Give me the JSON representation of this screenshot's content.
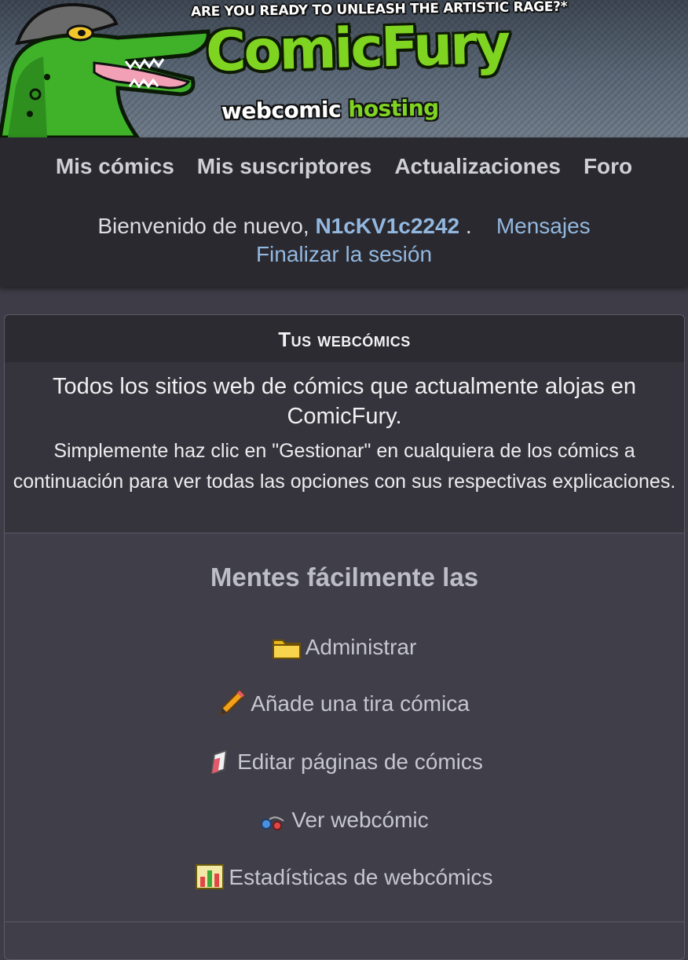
{
  "banner": {
    "tagline": "ARE YOU READY TO UNLEASH THE ARTISTIC RAGE?",
    "tagline_mark": "*",
    "logo_main": "ComicFury",
    "logo_sub_1": "webcomic",
    "logo_sub_2": "hosting"
  },
  "nav": {
    "items": [
      "Mis cómics",
      "Mis suscriptores",
      "Actualizaciones",
      "Foro"
    ]
  },
  "welcome": {
    "prefix": "Bienvenido de nuevo,",
    "username": "N1cKV1c2242",
    "suffix": ".",
    "messages": "Mensajes",
    "logout": "Finalizar la sesión"
  },
  "panel": {
    "title": "Tus webcómics",
    "intro_1": "Todos los sitios web de cómics que actualmente alojas en ComicFury.",
    "intro_2": "Simplemente haz clic en \"Gestionar\" en cualquiera de los cómics a continuación para ver todas las opciones con sus respectivas explicaciones.",
    "comic_title": "Mentes fácilmente las",
    "actions": [
      {
        "label": "Administrar",
        "icon": "folder-icon"
      },
      {
        "label": "Añade una tira cómica",
        "icon": "pencil-icon"
      },
      {
        "label": "Editar páginas de cómics",
        "icon": "eraser-icon"
      },
      {
        "label": "Ver webcómic",
        "icon": "link-icon"
      },
      {
        "label": "Estadísticas de webcómics",
        "icon": "stats-icon"
      }
    ]
  },
  "colors": {
    "page_bg": "#3d3c47",
    "nav_bg": "#2a292f",
    "link": "#93b8e0",
    "logo_green": "#7fd321"
  }
}
